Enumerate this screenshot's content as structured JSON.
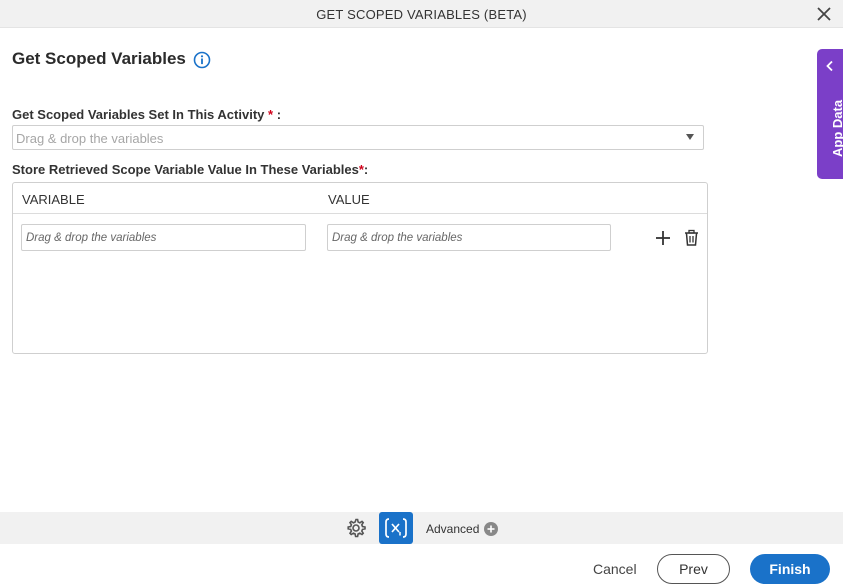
{
  "window": {
    "title": "GET SCOPED VARIABLES (BETA)",
    "close_icon": "close-icon"
  },
  "page": {
    "heading": "Get Scoped Variables",
    "info_icon": "info-icon"
  },
  "form": {
    "scoped_set_label": "Get Scoped Variables Set In This Activity",
    "scoped_set_required": "*",
    "scoped_set_suffix": " :",
    "scoped_set_placeholder": "Drag & drop the variables",
    "store_label": "Store Retrieved Scope Variable Value In These Variables",
    "store_required": "*",
    "store_suffix": ":"
  },
  "table": {
    "columns": [
      "VARIABLE",
      "VALUE"
    ],
    "rows": [
      {
        "variable_placeholder": "Drag & drop the variables",
        "value_placeholder": "Drag & drop the variables"
      }
    ]
  },
  "side_panel": {
    "label": "App Data"
  },
  "toolbar": {
    "advanced_label": "Advanced"
  },
  "footer": {
    "cancel_label": "Cancel",
    "prev_label": "Prev",
    "finish_label": "Finish"
  },
  "colors": {
    "accent_blue": "#1a72c9",
    "app_data_purple": "#7b3fc8",
    "required_red": "#d0021b"
  }
}
